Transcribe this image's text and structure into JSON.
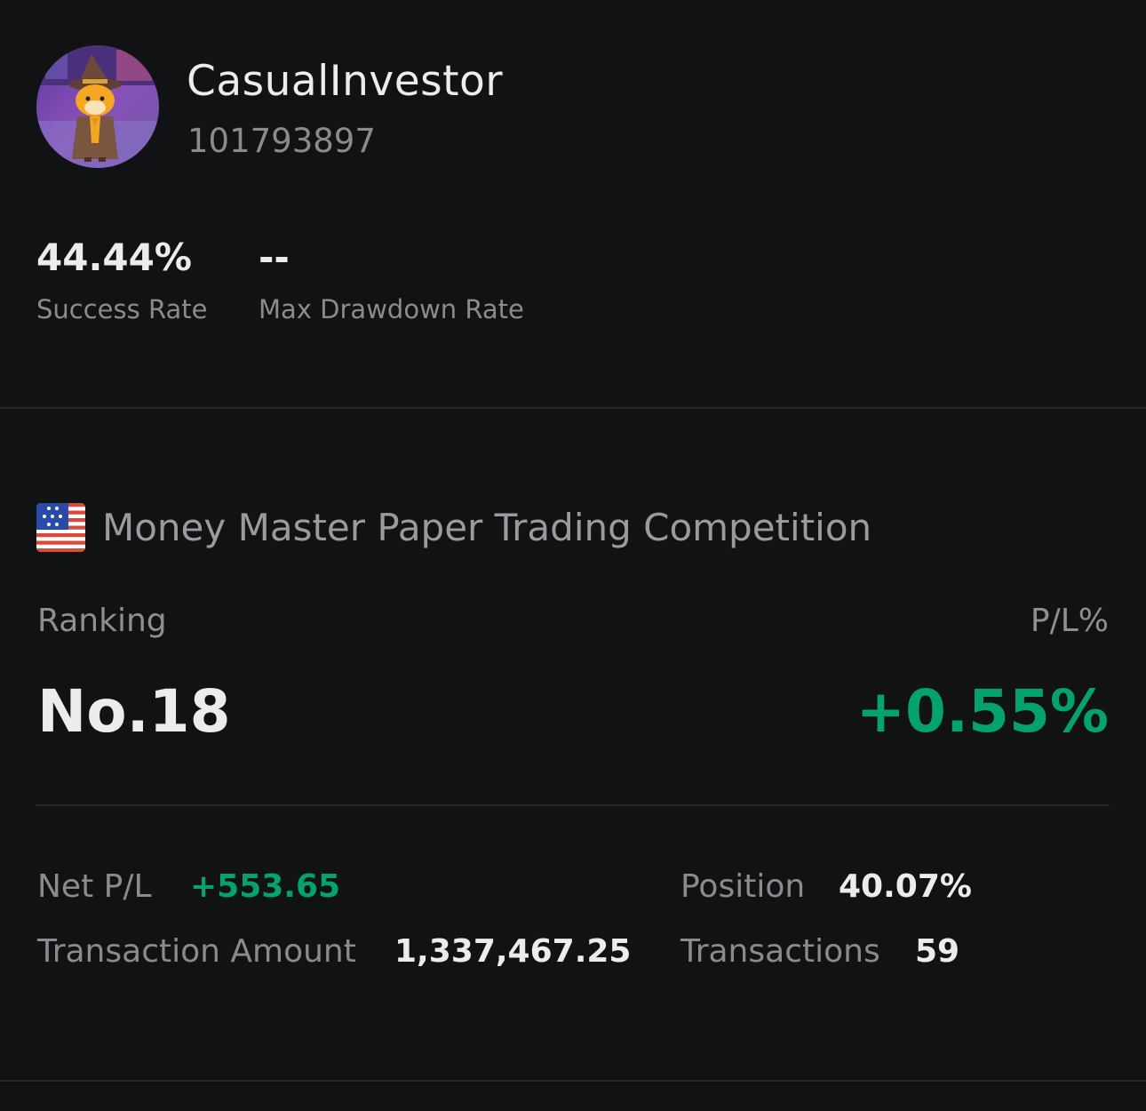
{
  "profile": {
    "username": "CasualInvestor",
    "user_id": "101793897",
    "avatar_icon": "mascot-wizard-avatar"
  },
  "stats": [
    {
      "value": "44.44%",
      "label": "Success Rate"
    },
    {
      "value": "--",
      "label": "Max Drawdown Rate"
    }
  ],
  "competition": {
    "flag_icon": "us-flag-icon",
    "title": "Money Master Paper Trading Competition",
    "ranking_label": "Ranking",
    "ranking_value": "No.18",
    "pl_label": "P/L%",
    "pl_value": "+0.55%",
    "details": {
      "net_pl_label": "Net P/L",
      "net_pl_value": "+553.65",
      "position_label": "Position",
      "position_value": "40.07%",
      "transaction_amount_label": "Transaction Amount",
      "transaction_amount_value": "1,337,467.25",
      "transactions_label": "Transactions",
      "transactions_value": "59"
    }
  },
  "colors": {
    "background": "#111214",
    "positive": "#04a36e",
    "primary_text": "#ececee",
    "secondary_text": "#8a8b8f",
    "divider": "#26272a"
  }
}
